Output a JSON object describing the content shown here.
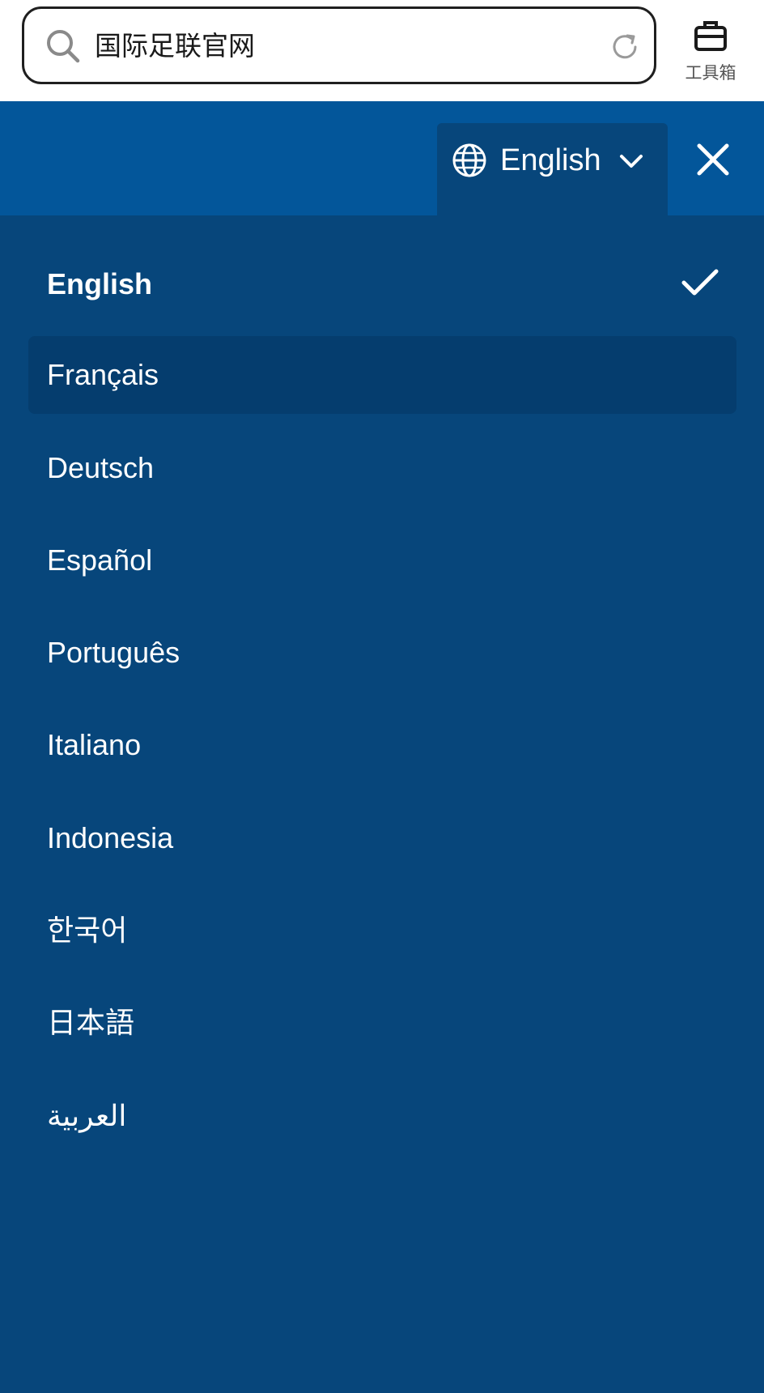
{
  "browser": {
    "search_text": "国际足联官网",
    "toolbox_label": "工具箱"
  },
  "header": {
    "current_language": "English"
  },
  "languages": {
    "selected": "English",
    "items": [
      {
        "label": "English"
      },
      {
        "label": "Français"
      },
      {
        "label": "Deutsch"
      },
      {
        "label": "Español"
      },
      {
        "label": "Português"
      },
      {
        "label": "Italiano"
      },
      {
        "label": "Indonesia"
      },
      {
        "label": "한국어"
      },
      {
        "label": "日本語"
      },
      {
        "label": "العربية"
      }
    ]
  },
  "colors": {
    "header_blue": "#03569a",
    "menu_blue": "#07467b",
    "hover_blue": "#053d6e",
    "text": "#ffffff"
  },
  "icons": [
    "search-icon",
    "reload-icon",
    "toolbox-icon",
    "globe-icon",
    "chevron-down-icon",
    "close-icon",
    "check-icon"
  ]
}
